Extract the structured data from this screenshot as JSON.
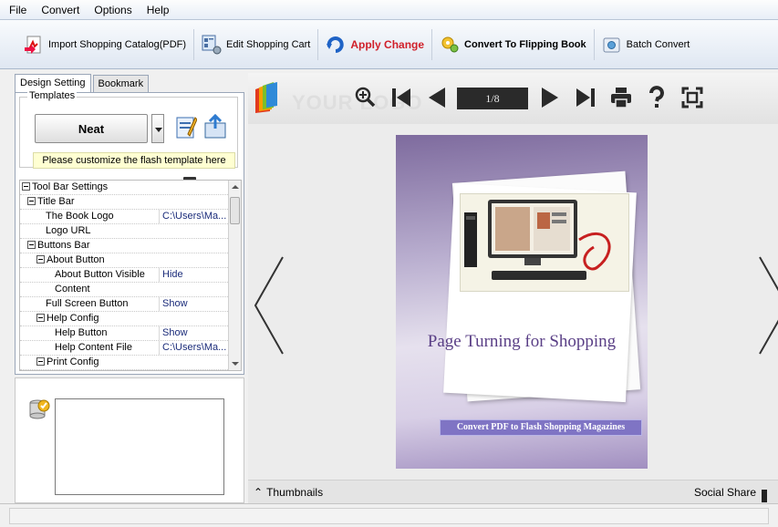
{
  "menu": [
    "File",
    "Convert",
    "Options",
    "Help"
  ],
  "toolbar": {
    "import_label": "Import Shopping Catalog(PDF)",
    "edit_label": "Edit Shopping Cart",
    "apply_label": "Apply Change",
    "convert_label": "Convert To Flipping Book",
    "batch_label": "Batch Convert"
  },
  "tabs": [
    "Design Setting",
    "Bookmark"
  ],
  "templates": {
    "legend": "Templates",
    "selected": "Neat",
    "hint": "Please customize the flash template here"
  },
  "tree": [
    {
      "label": "Tool Bar Settings",
      "value": "",
      "level": 0,
      "expand": true
    },
    {
      "label": "Title Bar",
      "value": "",
      "level": 1,
      "expand": true
    },
    {
      "label": "The Book Logo",
      "value": "C:\\Users\\Ma...",
      "level": 3,
      "expand": false
    },
    {
      "label": "Logo URL",
      "value": "",
      "level": 3,
      "expand": false
    },
    {
      "label": "Buttons Bar",
      "value": "",
      "level": 1,
      "expand": true
    },
    {
      "label": "About Button",
      "value": "",
      "level": 2,
      "expand": true
    },
    {
      "label": "About Button Visible",
      "value": "Hide",
      "level": 4,
      "expand": false
    },
    {
      "label": "Content",
      "value": "",
      "level": 4,
      "expand": false
    },
    {
      "label": "Full Screen Button",
      "value": "Show",
      "level": 3,
      "expand": false
    },
    {
      "label": "Help Config",
      "value": "",
      "level": 2,
      "expand": true
    },
    {
      "label": "Help Button",
      "value": "Show",
      "level": 4,
      "expand": false
    },
    {
      "label": "Help Content File",
      "value": "C:\\Users\\Ma...",
      "level": 4,
      "expand": false
    },
    {
      "label": "Print Config",
      "value": "",
      "level": 2,
      "expand": true
    }
  ],
  "viewer": {
    "logo_text": "YOUR LOGO",
    "page_indicator": "1/8",
    "book_title": "Page Turning for Shopping",
    "book_banner": "Convert PDF to  Flash Shopping Magazines",
    "thumbnails_label": "Thumbnails",
    "social_label": "Social Share"
  },
  "colors": {
    "apply_red": "#d0202a",
    "tree_value": "#1a2b7a",
    "book_title": "#5a3f86"
  }
}
